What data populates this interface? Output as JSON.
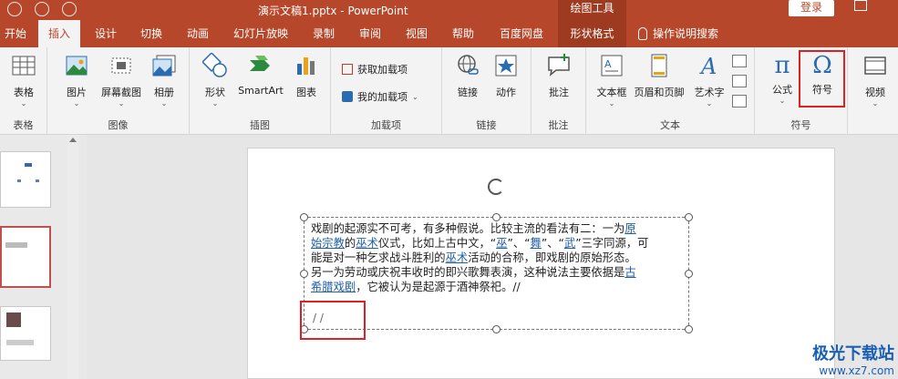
{
  "window": {
    "title": "演示文稿1.pptx  -  PowerPoint",
    "context_tab_group": "绘图工具",
    "login_label": "登录"
  },
  "tabs": [
    "开始",
    "插入",
    "设计",
    "切换",
    "动画",
    "幻灯片放映",
    "录制",
    "审阅",
    "视图",
    "帮助",
    "百度网盘",
    "形状格式"
  ],
  "active_tab": "插入",
  "search_label": "操作说明搜索",
  "ribbon": {
    "groups": {
      "tables": "表格",
      "images": "图像",
      "illustrations": "插图",
      "addins": "加载项",
      "links": "链接",
      "comments": "批注",
      "text": "文本",
      "symbols": "符号"
    },
    "buttons": {
      "table": "表格",
      "picture": "图片",
      "screenshot": "屏幕截图",
      "album": "相册",
      "shapes": "形状",
      "smartart": "SmartArt",
      "chart": "图表",
      "get_addins": "获取加载项",
      "my_addins": "我的加载项",
      "link": "链接",
      "action": "动作",
      "comment": "批注",
      "textbox": "文本框",
      "header_footer": "页眉和页脚",
      "wordart": "艺术字",
      "equation": "公式",
      "symbol": "符号",
      "video": "视频"
    }
  },
  "slide_text": {
    "l1a": "戏剧的起源实不可考，有多种假说。比较主流的看法有二：一为",
    "l1link": "原",
    "l2link": "始宗教",
    "l2a": "的",
    "l2link2": "巫术",
    "l2b": "仪式，比如上古中文，“",
    "l2q1": "巫",
    "l2c": "”、“",
    "l2q2": "舞",
    "l2d": "”、“",
    "l2q3": "武",
    "l2e": "”三字同源，可",
    "l3a": "能是对一种乞求战斗胜利的",
    "l3link": "巫术",
    "l3b": "活动的合称，即戏剧的原始形态。",
    "l4a": "另一为劳动或庆祝丰收时的即兴歌舞表演，这种说法主要依据是",
    "l4link": "古",
    "l5link": "希腊戏剧",
    "l5a": "，它被认为是起源于酒神祭祀。//",
    "slashes": "/ /"
  },
  "watermark": {
    "line1": "极光下载站",
    "line2": "www.xz7.com"
  },
  "colors": {
    "accent": "#b7472a",
    "highlight": "#e02020",
    "link": "#1f5fa8"
  }
}
